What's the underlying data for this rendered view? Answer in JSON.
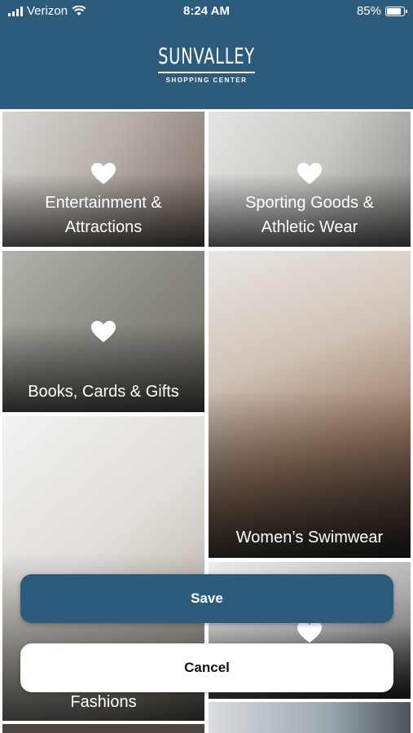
{
  "status_bar": {
    "carrier": "Verizon",
    "time": "8:24 AM",
    "battery": "85%",
    "battery_level": 0.85
  },
  "logo": {
    "name": "SUNVALLEY",
    "subtitle": "SHOPPING CENTER"
  },
  "categories": [
    {
      "line1": "Entertainment &",
      "line2": "Attractions",
      "icon": "heart-icon"
    },
    {
      "line1": "Sporting Goods &",
      "line2": "Athletic Wear",
      "icon": "heart-icon"
    },
    {
      "line1": "Books, Cards & Gifts",
      "icon": "heart-icon"
    },
    {
      "line1": "Women’s Swimwear"
    },
    {
      "line1": "Fashions"
    },
    {
      "icon": "heart-icon"
    }
  ],
  "actions": {
    "save_label": "Save",
    "cancel_label": "Cancel"
  },
  "colors": {
    "brand": "#2c5b7c",
    "text_on_brand": "#ffffff"
  }
}
